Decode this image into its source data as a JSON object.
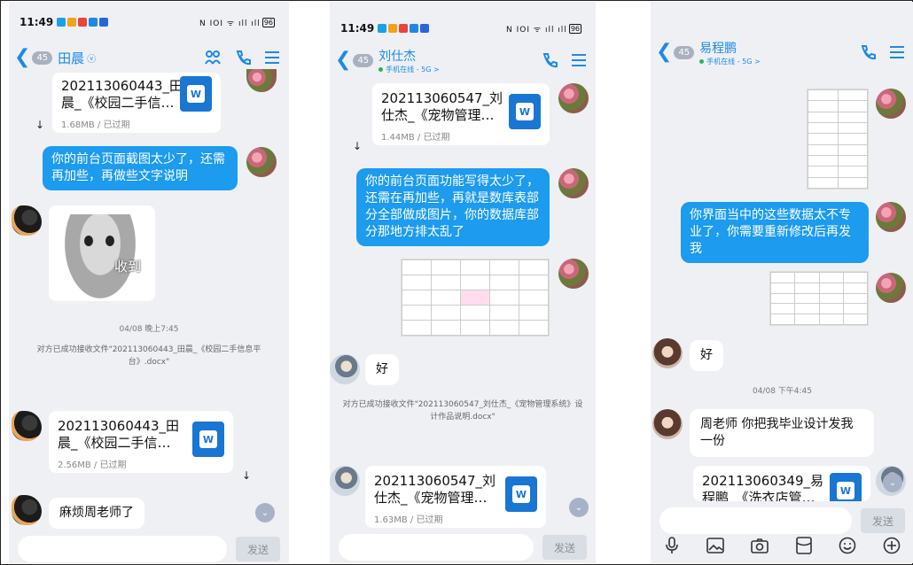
{
  "panel1": {
    "status": {
      "time": "11:49",
      "right": "N IOI ᯤ ıll ıll",
      "battery": "96"
    },
    "header": {
      "unread": "45",
      "name": "田晨"
    },
    "file_top": {
      "title": "202113060443_田\n晨_《校园二手信…",
      "meta": "1.68MB / 已过期"
    },
    "msg_out": "你的前台页面截图太少了，还需再加些，再做些文字说明",
    "sticker_text": "收到",
    "time_sep": "04/08 晚上7:45",
    "sys_text": "对方已成功接收文件\"202113060443_田晨_《校园二手信息平台》.docx\"",
    "file_bottom": {
      "title": "202113060443_田\n晨_《校园二手信…",
      "meta": "2.56MB / 已过期"
    },
    "msg_in": "麻烦周老师了",
    "send_label": "发送"
  },
  "panel2": {
    "status": {
      "time": "11:49",
      "right": "N IOI ᯤ ıll ıll",
      "battery": "96"
    },
    "header": {
      "unread": "45",
      "name": "刘仕杰",
      "substatus": "手机在线 - 5G >"
    },
    "file_top": {
      "title": "202113060547_刘\n仕杰_《宠物管理…",
      "meta": "1.44MB / 已过期"
    },
    "msg_out": "你的前台页面功能写得太少了，还需在再加些，再就是数库表部分全部做成图片，你的数据库部分那地方排太乱了",
    "msg_in": "好",
    "sys_text": "对方已成功接收文件\"202113060547_刘仕杰_《宠物管理系统》设计作品说明.docx\"",
    "file_bottom": {
      "title": "202113060547_刘\n仕杰_《宠物管理…",
      "meta": "1.63MB / 已过期"
    },
    "send_label": "发送"
  },
  "panel3": {
    "header": {
      "unread": "45",
      "name": "易程鹏",
      "substatus": "手机在线 - 5G >"
    },
    "msg_out": "你界面当中的这些数据太不专业了，你需要重新修改后再发我",
    "msg_in_1": "好",
    "time_sep": "04/08 下午4:45",
    "msg_in_2": "周老师 你把我毕业设计发我一份",
    "file_bottom": {
      "title": "202113060349_易\n程鹏_《洗衣店管…"
    },
    "send_label": "发送"
  },
  "colors": {
    "accent": "#1d8ae8",
    "bubble_out": "#1c9bef",
    "bg": "#eef0f4"
  }
}
